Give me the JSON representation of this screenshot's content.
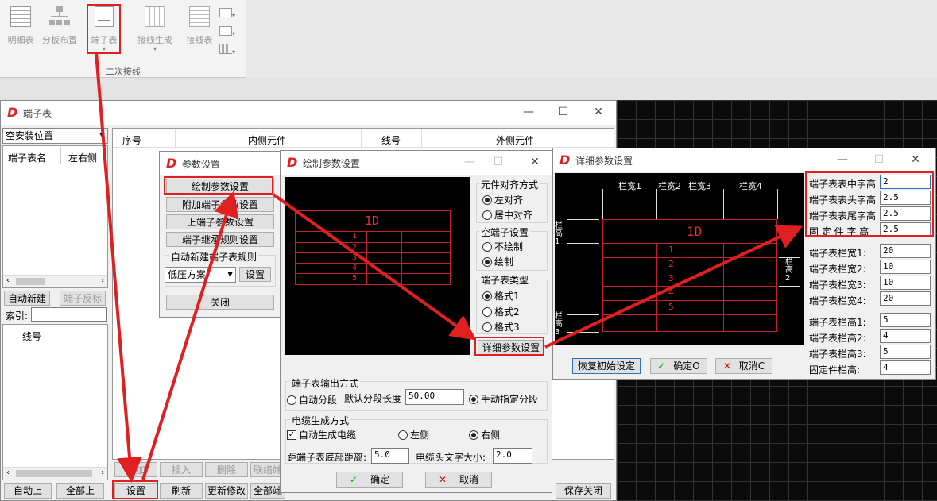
{
  "ribbon": {
    "tools": [
      "明细表",
      "分板布置",
      "端子表",
      "接线生成",
      "接线表"
    ],
    "group_label": "二次接线"
  },
  "terminal_window": {
    "title": "端子表",
    "combo": "空安装位置",
    "left_cols": [
      "端子表名",
      "左右侧"
    ],
    "btn_auto_new": "自动新建",
    "btn_reverse": "端子反标",
    "index_label": "索引:",
    "tree_item": "线号",
    "grid_cols": [
      "序号",
      "内侧元件",
      "线号",
      "外侧元件"
    ],
    "bottom_row1": [
      "增加",
      "插入",
      "删除",
      "联络端"
    ],
    "bottom_row2": [
      "自动上",
      "全部上",
      "设置",
      "刷新",
      "更新修改",
      "全部端",
      "保存关闭"
    ]
  },
  "param_dialog": {
    "title": "参数设置",
    "btn_draw": "绘制参数设置",
    "btn_addl": "附加端子参数设置",
    "btn_upper": "上端子参数设置",
    "btn_relay": "端子继承规则设置",
    "auto_rule_label": "自动新建端子表规则",
    "scheme": "低压方案",
    "btn_set": "设置",
    "btn_close": "关闭"
  },
  "draw_dialog": {
    "title": "绘制参数设置",
    "align_title": "元件对齐方式",
    "align_left": "左对齐",
    "align_center": "居中对齐",
    "empty_title": "空端子设置",
    "empty_no": "不绘制",
    "empty_yes": "绘制",
    "type_title": "端子表类型",
    "type1": "格式1",
    "type2": "格式2",
    "type3": "格式3",
    "btn_detail": "详细参数设置",
    "output_title": "端子表输出方式",
    "auto_seg": "自动分段",
    "default_len_label": "默认分段长度",
    "default_len": "50.00",
    "manual_seg": "手动指定分段",
    "cable_title": "电缆生成方式",
    "auto_cable": "自动生成电缆",
    "left_side": "左侧",
    "right_side": "右侧",
    "bottom_dist_label": "距端子表底部距离:",
    "bottom_dist": "5.0",
    "cable_font_label": "电缆头文字大小:",
    "cable_font": "2.0",
    "btn_ok": "确定",
    "btn_cancel": "取消",
    "preview": {
      "header": "1D",
      "rows": [
        "1",
        "2",
        "3",
        "4",
        "5"
      ]
    }
  },
  "detail_dialog": {
    "title": "详细参数设置",
    "fields": [
      {
        "label": "端子表表中字高",
        "value": "2"
      },
      {
        "label": "端子表表头字高",
        "value": "2.5"
      },
      {
        "label": "端子表表尾字高",
        "value": "2.5"
      },
      {
        "label": "固 定 件 字 高",
        "value": "2.5"
      }
    ],
    "widths": [
      {
        "label": "端子表栏宽1:",
        "value": "20"
      },
      {
        "label": "端子表栏宽2:",
        "value": "10"
      },
      {
        "label": "端子表栏宽3:",
        "value": "10"
      },
      {
        "label": "端子表栏宽4:",
        "value": "20"
      }
    ],
    "heights": [
      {
        "label": "端子表栏高1:",
        "value": "5"
      },
      {
        "label": "端子表栏高2:",
        "value": "4"
      },
      {
        "label": "端子表栏高3:",
        "value": "5"
      },
      {
        "label": "固定件栏高:",
        "value": "4"
      }
    ],
    "btn_restore": "恢复初始设定",
    "btn_ok": "确定O",
    "btn_cancel": "取消C",
    "preview": {
      "cols": [
        "栏宽1",
        "栏宽2",
        "栏宽3",
        "栏宽4"
      ],
      "header": "1D",
      "rows": [
        "1",
        "2",
        "3",
        "4",
        "5"
      ],
      "side1": "栏高1",
      "side2": "栏高2",
      "side3": "栏高3"
    }
  }
}
